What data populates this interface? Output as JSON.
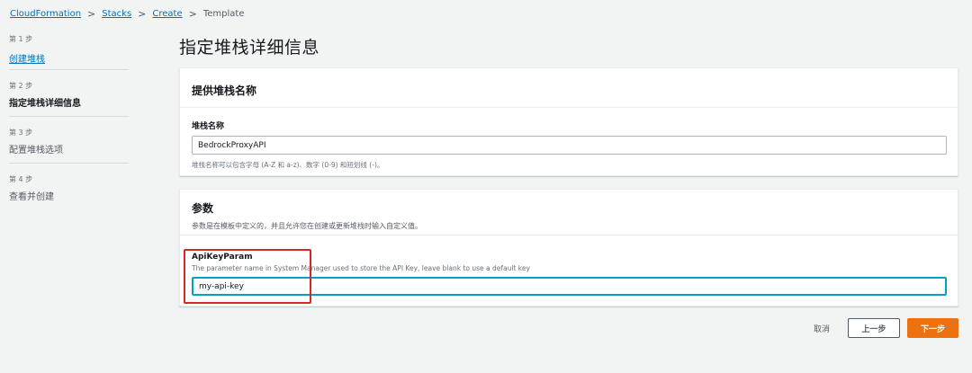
{
  "breadcrumb": {
    "items": [
      "CloudFormation",
      "Stacks",
      "Create"
    ],
    "current": "Template"
  },
  "steps": [
    {
      "num": "第 1 步",
      "label": "创建堆栈"
    },
    {
      "num": "第 2 步",
      "label": "指定堆栈详细信息"
    },
    {
      "num": "第 3 步",
      "label": "配置堆栈选项"
    },
    {
      "num": "第 4 步",
      "label": "查看并创建"
    }
  ],
  "page": {
    "title": "指定堆栈详细信息"
  },
  "stack_name_panel": {
    "title": "提供堆栈名称",
    "field_label": "堆栈名称",
    "value": "BedrockProxyAPI",
    "hint": "堆栈名称可以包含字母 (A-Z 和 a-z)、数字 (0-9) 和短划线 (-)。"
  },
  "params_panel": {
    "title": "参数",
    "description": "参数是在模板中定义的，并且允许您在创建或更新堆栈时输入自定义值。",
    "param": {
      "name": "ApiKeyParam",
      "description": "The parameter name in System Manager used to store the API Key, leave blank to use a default key",
      "value": "my-api-key"
    }
  },
  "actions": {
    "cancel": "取消",
    "previous": "上一步",
    "next": "下一步"
  },
  "colors": {
    "link": "#0073bb",
    "primary_button": "#ec7211",
    "highlight_box": "#d62828",
    "focus_border": "#00a1c9"
  }
}
